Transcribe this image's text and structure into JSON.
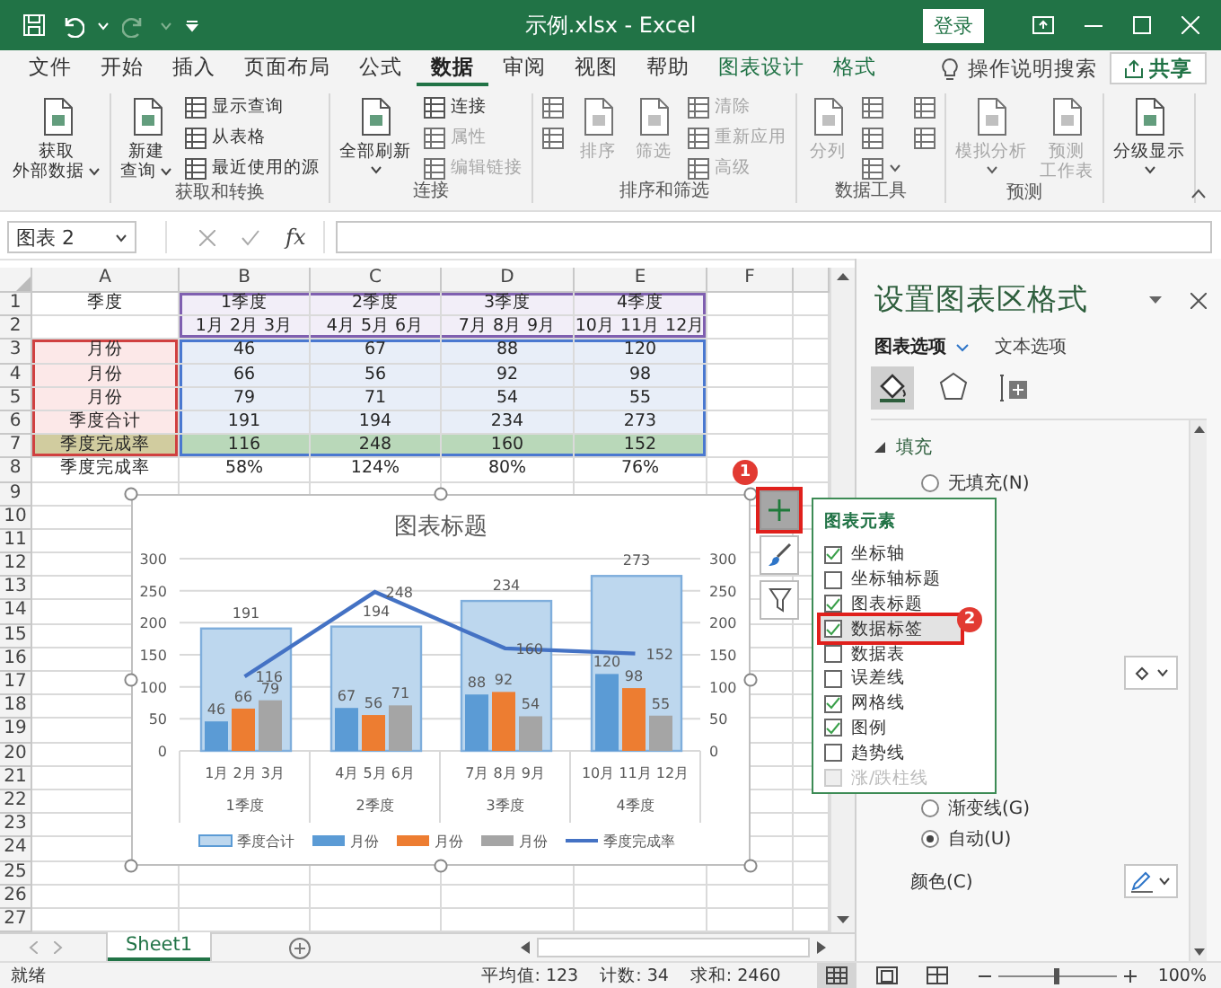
{
  "title_bar": {
    "title": "示例.xlsx - Excel",
    "login": "登录"
  },
  "menu_tabs": [
    {
      "label": "文件",
      "selected": false,
      "kind": "standard"
    },
    {
      "label": "开始",
      "selected": false,
      "kind": "standard"
    },
    {
      "label": "插入",
      "selected": false,
      "kind": "standard"
    },
    {
      "label": "页面布局",
      "selected": false,
      "kind": "standard"
    },
    {
      "label": "公式",
      "selected": false,
      "kind": "standard"
    },
    {
      "label": "数据",
      "selected": true,
      "kind": "standard"
    },
    {
      "label": "审阅",
      "selected": false,
      "kind": "standard"
    },
    {
      "label": "视图",
      "selected": false,
      "kind": "standard"
    },
    {
      "label": "帮助",
      "selected": false,
      "kind": "standard"
    },
    {
      "label": "图表设计",
      "selected": false,
      "kind": "contextual"
    },
    {
      "label": "格式",
      "selected": false,
      "kind": "contextual"
    }
  ],
  "tell_me": "操作说明搜索",
  "share": "共享",
  "ribbon_groups": [
    {
      "commands": [
        {
          "kind": "large",
          "lines": [
            "获取",
            "外部数据"
          ],
          "menu": true,
          "disabled": false
        }
      ]
    },
    {
      "label": "获取和转换",
      "commands": [
        {
          "kind": "large",
          "lines": [
            "新建",
            "查询"
          ],
          "menu": true,
          "disabled": false
        },
        {
          "kind": "small",
          "label": "显示查询",
          "menu": false,
          "disabled": false
        },
        {
          "kind": "small",
          "label": "从表格",
          "menu": false,
          "disabled": false
        },
        {
          "kind": "small",
          "label": "最近使用的源",
          "menu": false,
          "disabled": false
        }
      ]
    },
    {
      "label": "连接",
      "commands": [
        {
          "kind": "large",
          "label": "全部刷新",
          "menu": true,
          "disabled": false
        },
        {
          "kind": "small",
          "label": "连接",
          "menu": false,
          "disabled": false
        },
        {
          "kind": "small",
          "label": "属性",
          "menu": false,
          "disabled": true
        },
        {
          "kind": "small",
          "label": "编辑链接",
          "menu": false,
          "disabled": true
        }
      ]
    },
    {
      "label": "排序和筛选",
      "commands": [
        {
          "kind": "icon",
          "menu": false,
          "disabled": true
        },
        {
          "kind": "icon",
          "menu": false,
          "disabled": true
        },
        {
          "kind": "large",
          "label": "排序",
          "menu": false,
          "disabled": true
        },
        {
          "kind": "large",
          "label": "筛选",
          "menu": false,
          "disabled": true
        },
        {
          "kind": "small",
          "label": "清除",
          "menu": false,
          "disabled": true
        },
        {
          "kind": "small",
          "label": "重新应用",
          "menu": false,
          "disabled": true
        },
        {
          "kind": "small",
          "label": "高级",
          "menu": false,
          "disabled": true
        }
      ]
    },
    {
      "label": "数据工具",
      "commands": [
        {
          "kind": "large",
          "label": "分列",
          "menu": false,
          "disabled": true
        },
        {
          "kind": "icon",
          "menu": false,
          "disabled": true
        },
        {
          "kind": "icon",
          "menu": false,
          "disabled": true
        },
        {
          "kind": "icon",
          "menu": true,
          "disabled": true
        },
        {
          "kind": "icon",
          "menu": false,
          "disabled": true
        },
        {
          "kind": "icon",
          "menu": false,
          "disabled": true
        }
      ]
    },
    {
      "label": "预测",
      "commands": [
        {
          "kind": "large",
          "label": "模拟分析",
          "menu": true,
          "disabled": true
        },
        {
          "kind": "large",
          "lines": [
            "预测",
            "工作表"
          ],
          "menu": false,
          "disabled": true
        }
      ]
    },
    {
      "commands": [
        {
          "kind": "large",
          "label": "分级显示",
          "menu": true,
          "disabled": false
        }
      ]
    }
  ],
  "formula_bar": {
    "name_box": "图表 2",
    "insert_function": "fx"
  },
  "sheet": {
    "columns": [
      "A",
      "B",
      "C",
      "D",
      "E",
      "F"
    ],
    "rows": [
      {
        "number": "1",
        "kind": "header",
        "cells": {
          "A": "季度",
          "B": "1季度",
          "C": "2季度",
          "D": "3季度",
          "E": "4季度"
        }
      },
      {
        "number": "2",
        "kind": "header",
        "cells": {
          "B": "1月 2月 3月",
          "C": "4月 5月 6月",
          "D": "7月 8月 9月",
          "E": "10月 11月 12月"
        }
      },
      {
        "number": "3",
        "kind": "data",
        "cells": {
          "A": "月份",
          "B": "46",
          "C": "67",
          "D": "88",
          "E": "120"
        }
      },
      {
        "number": "4",
        "kind": "data",
        "cells": {
          "A": "月份",
          "B": "66",
          "C": "56",
          "D": "92",
          "E": "98"
        }
      },
      {
        "number": "5",
        "kind": "data",
        "cells": {
          "A": "月份",
          "B": "79",
          "C": "71",
          "D": "54",
          "E": "55"
        }
      },
      {
        "number": "6",
        "kind": "data",
        "cells": {
          "A": "季度合计",
          "B": "191",
          "C": "194",
          "D": "234",
          "E": "273"
        }
      },
      {
        "number": "7",
        "kind": "highlight",
        "cells": {
          "A": "季度完成率",
          "B": "116",
          "C": "248",
          "D": "160",
          "E": "152"
        }
      },
      {
        "number": "8",
        "kind": "plain",
        "cells": {
          "A": "季度完成率",
          "B": "58%",
          "C": "124%",
          "D": "80%",
          "E": "76%"
        }
      },
      {
        "number": "9",
        "kind": "plain"
      },
      {
        "number": "10",
        "kind": "plain"
      },
      {
        "number": "11",
        "kind": "plain"
      },
      {
        "number": "12",
        "kind": "plain"
      },
      {
        "number": "13",
        "kind": "plain"
      },
      {
        "number": "14",
        "kind": "plain"
      },
      {
        "number": "15",
        "kind": "plain"
      },
      {
        "number": "16",
        "kind": "plain"
      },
      {
        "number": "17",
        "kind": "plain"
      },
      {
        "number": "18",
        "kind": "plain"
      },
      {
        "number": "19",
        "kind": "plain"
      },
      {
        "number": "20",
        "kind": "plain"
      },
      {
        "number": "21",
        "kind": "plain"
      },
      {
        "number": "22",
        "kind": "plain"
      },
      {
        "number": "23",
        "kind": "plain"
      },
      {
        "number": "24",
        "kind": "plain"
      },
      {
        "number": "25",
        "kind": "plain"
      },
      {
        "number": "26",
        "kind": "plain"
      },
      {
        "number": "27",
        "kind": "plain"
      }
    ]
  },
  "chart": {
    "category_months": [
      "1月 2月 3月",
      "4月 5月 6月",
      "7月 8月 9月",
      "10月 11月 12月"
    ],
    "chart_data": {
      "type": "bar",
      "title": "图表标题",
      "categories": [
        "1季度",
        "2季度",
        "3季度",
        "4季度"
      ],
      "series": [
        {
          "name": "季度合计",
          "color": "#bdd7ee",
          "type": "bar",
          "axis": "y2",
          "values": [
            191,
            194,
            234,
            273
          ],
          "value_labels": [
            "191",
            "194",
            "234",
            "273"
          ]
        },
        {
          "name": "月份",
          "color": "#5b9bd5",
          "type": "bar",
          "values": [
            46,
            67,
            88,
            120
          ],
          "value_labels": [
            "46",
            "67",
            "88",
            "120"
          ]
        },
        {
          "name": "月份",
          "color": "#ed7d31",
          "type": "bar",
          "values": [
            66,
            56,
            92,
            98
          ],
          "value_labels": [
            "66",
            "56",
            "92",
            "98"
          ]
        },
        {
          "name": "月份",
          "color": "#a5a5a5",
          "type": "bar",
          "values": [
            79,
            71,
            54,
            55
          ],
          "value_labels": [
            "79",
            "71",
            "54",
            "55"
          ]
        },
        {
          "name": "季度完成率",
          "color": "#4472c4",
          "type": "line",
          "values": [
            116,
            248,
            160,
            152
          ],
          "value_labels": [
            "116",
            "248",
            "160",
            "152"
          ]
        }
      ],
      "stacked": false,
      "grid": true,
      "legend": "bottom",
      "ylim": [
        0,
        300
      ],
      "yticks": [
        0,
        50,
        100,
        150,
        200,
        250,
        300
      ],
      "y2lim": [
        0,
        300
      ],
      "y2ticks": [
        0,
        50,
        100,
        150,
        200,
        250,
        300
      ],
      "data_labels": true
    }
  },
  "chart_tools": {
    "buttons": [
      {
        "kind": "elements",
        "selected": true
      },
      {
        "kind": "styles",
        "selected": false
      },
      {
        "kind": "filter",
        "selected": false
      }
    ],
    "popup": {
      "title": "图表元素",
      "items": [
        {
          "label": "坐标轴",
          "checked": true,
          "selected": false,
          "disabled": false
        },
        {
          "label": "坐标轴标题",
          "checked": false,
          "selected": false,
          "disabled": false
        },
        {
          "label": "图表标题",
          "checked": true,
          "selected": false,
          "disabled": false
        },
        {
          "label": "数据标签",
          "checked": true,
          "selected": true,
          "disabled": false
        },
        {
          "label": "数据表",
          "checked": false,
          "selected": false,
          "disabled": false
        },
        {
          "label": "误差线",
          "checked": false,
          "selected": false,
          "disabled": false
        },
        {
          "label": "网格线",
          "checked": true,
          "selected": false,
          "disabled": false
        },
        {
          "label": "图例",
          "checked": true,
          "selected": false,
          "disabled": false
        },
        {
          "label": "趋势线",
          "checked": false,
          "selected": false,
          "disabled": false
        },
        {
          "label": "涨/跌柱线",
          "checked": false,
          "selected": false,
          "disabled": true
        }
      ]
    },
    "callouts": [
      {
        "label": "1"
      },
      {
        "label": "2"
      }
    ]
  },
  "format_pane": {
    "title": "设置图表区格式",
    "tabs": [
      {
        "label": "图表选项",
        "selected": true
      },
      {
        "label": "文本选项",
        "selected": false
      }
    ],
    "icon_tabs": [
      {
        "kind": "fill",
        "selected": true
      },
      {
        "kind": "effects",
        "selected": false
      },
      {
        "kind": "size",
        "selected": false
      }
    ],
    "section": {
      "label": "填充",
      "expanded": true
    },
    "fill_options": [
      {
        "label": "无填充(N)",
        "selected": false
      }
    ],
    "line_options": [
      {
        "label": "渐变线(G)",
        "selected": false
      },
      {
        "label": "自动(U)",
        "selected": true
      }
    ],
    "color_label": "颜色(C)"
  },
  "sheet_tabs": [
    {
      "label": "Sheet1",
      "selected": true
    }
  ],
  "status_bar": {
    "ready": "就绪",
    "stats": [
      "平均值: 123",
      "计数: 34",
      "求和: 2460"
    ],
    "views": [
      {
        "kind": "normal",
        "selected": true
      },
      {
        "kind": "page_layout",
        "selected": false
      },
      {
        "kind": "page_break",
        "selected": false
      }
    ],
    "zoom": {
      "level": 0.48,
      "reading": "100%"
    }
  }
}
